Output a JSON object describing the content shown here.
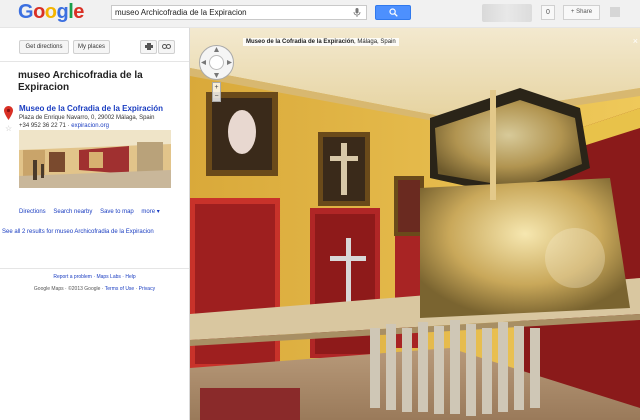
{
  "header": {
    "logo": "Google",
    "search_value": "museo Archicofradia de la Expiracion",
    "count": "0",
    "share_label": "+ Share"
  },
  "sidebar": {
    "get_directions": "Get directions",
    "my_places": "My places",
    "place_title": "museo Archicofradia de la Expiracion",
    "result": {
      "name": "Museo de la Cofradia de la Expiración",
      "address": "Plaza de Enrique Navarro, 0, 29002 Málaga, Spain",
      "phone": "+34 952 36 22 71",
      "website": "expiracion.org"
    },
    "actions": [
      "Directions",
      "Search nearby",
      "Save to map",
      "more ▾"
    ],
    "see_all": "See all 2 results for museo Archicofradia de la Expiracion",
    "footer": {
      "report": "Report a problem",
      "sep1": "·",
      "maps_labs": "Maps Labs",
      "sep2": "·",
      "help": "Help",
      "copyright": "Google Maps · ©2013 Google · ",
      "terms": "Terms of Use",
      "sep3": " · ",
      "privacy": "Privacy"
    }
  },
  "streetview": {
    "location_name": "Museo de la Cofradia de la Expiración",
    "location_detail": ", Málaga, Spain",
    "zoom_in": "+",
    "zoom_out": "−",
    "close": "×"
  },
  "colors": {
    "link": "#1a3dc1",
    "search_button": "#4d90fe",
    "wall_yellow": "#e8c24a",
    "wall_red": "#8a1a1a",
    "pin": "#d93025"
  }
}
